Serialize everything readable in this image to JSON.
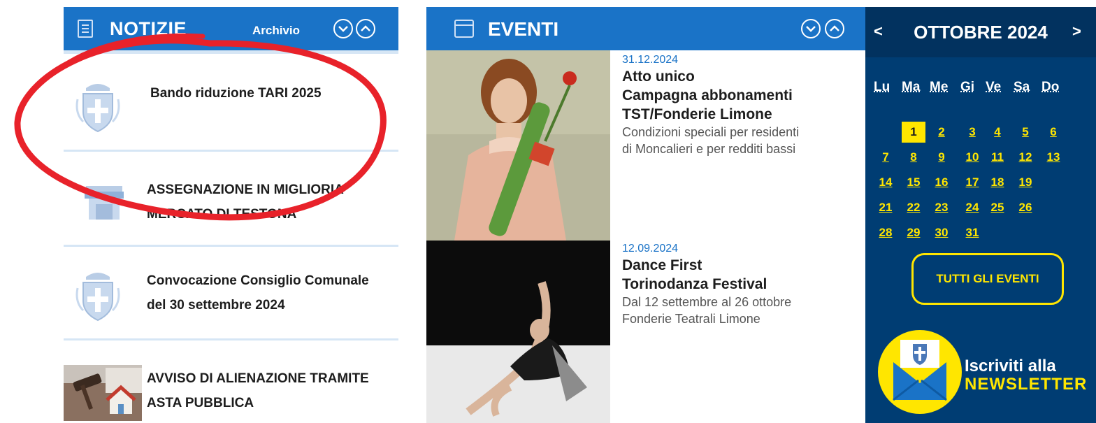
{
  "news": {
    "title": "NOTIZIE",
    "archive_label": "Archivio",
    "items": [
      {
        "title": "Bando riduzione TARI 2025"
      },
      {
        "title": "ASSEGNAZIONE IN MIGLIORIA MERCATO DI TESTONA"
      },
      {
        "title": "Convocazione Consiglio Comunale del 30 settembre 2024"
      },
      {
        "title": "AVVISO DI ALIENAZIONE TRAMITE ASTA PUBBLICA"
      }
    ]
  },
  "events": {
    "title": "EVENTI",
    "items": [
      {
        "date": "31.12.2024",
        "title1": "Atto unico",
        "title2": "Campagna abbonamenti",
        "title3": "TST/Fonderie Limone",
        "desc1": "Condizioni speciali per residenti",
        "desc2": "di Moncalieri e per redditi bassi"
      },
      {
        "date": "12.09.2024",
        "title1": "Dance First",
        "title2": "Torinodanza Festival",
        "desc1": "Dal 12 settembre al 26 ottobre",
        "desc2": "Fonderie Teatrali Limone"
      }
    ]
  },
  "calendar": {
    "prev": "<",
    "next": ">",
    "month": "OTTOBRE 2024",
    "weekdays": [
      "Lu",
      "Ma",
      "Me",
      "Gi",
      "Ve",
      "Sa",
      "Do"
    ],
    "today": "1",
    "all_events_label": "TUTTI GLI EVENTI",
    "newsletter_line1": "Iscriviti alla",
    "newsletter_line2": "NEWSLETTER"
  },
  "colors": {
    "primary_blue": "#1a73c7",
    "dark_blue": "#003d73",
    "accent_yellow": "#ffe600",
    "marker_red": "#e8222a"
  }
}
